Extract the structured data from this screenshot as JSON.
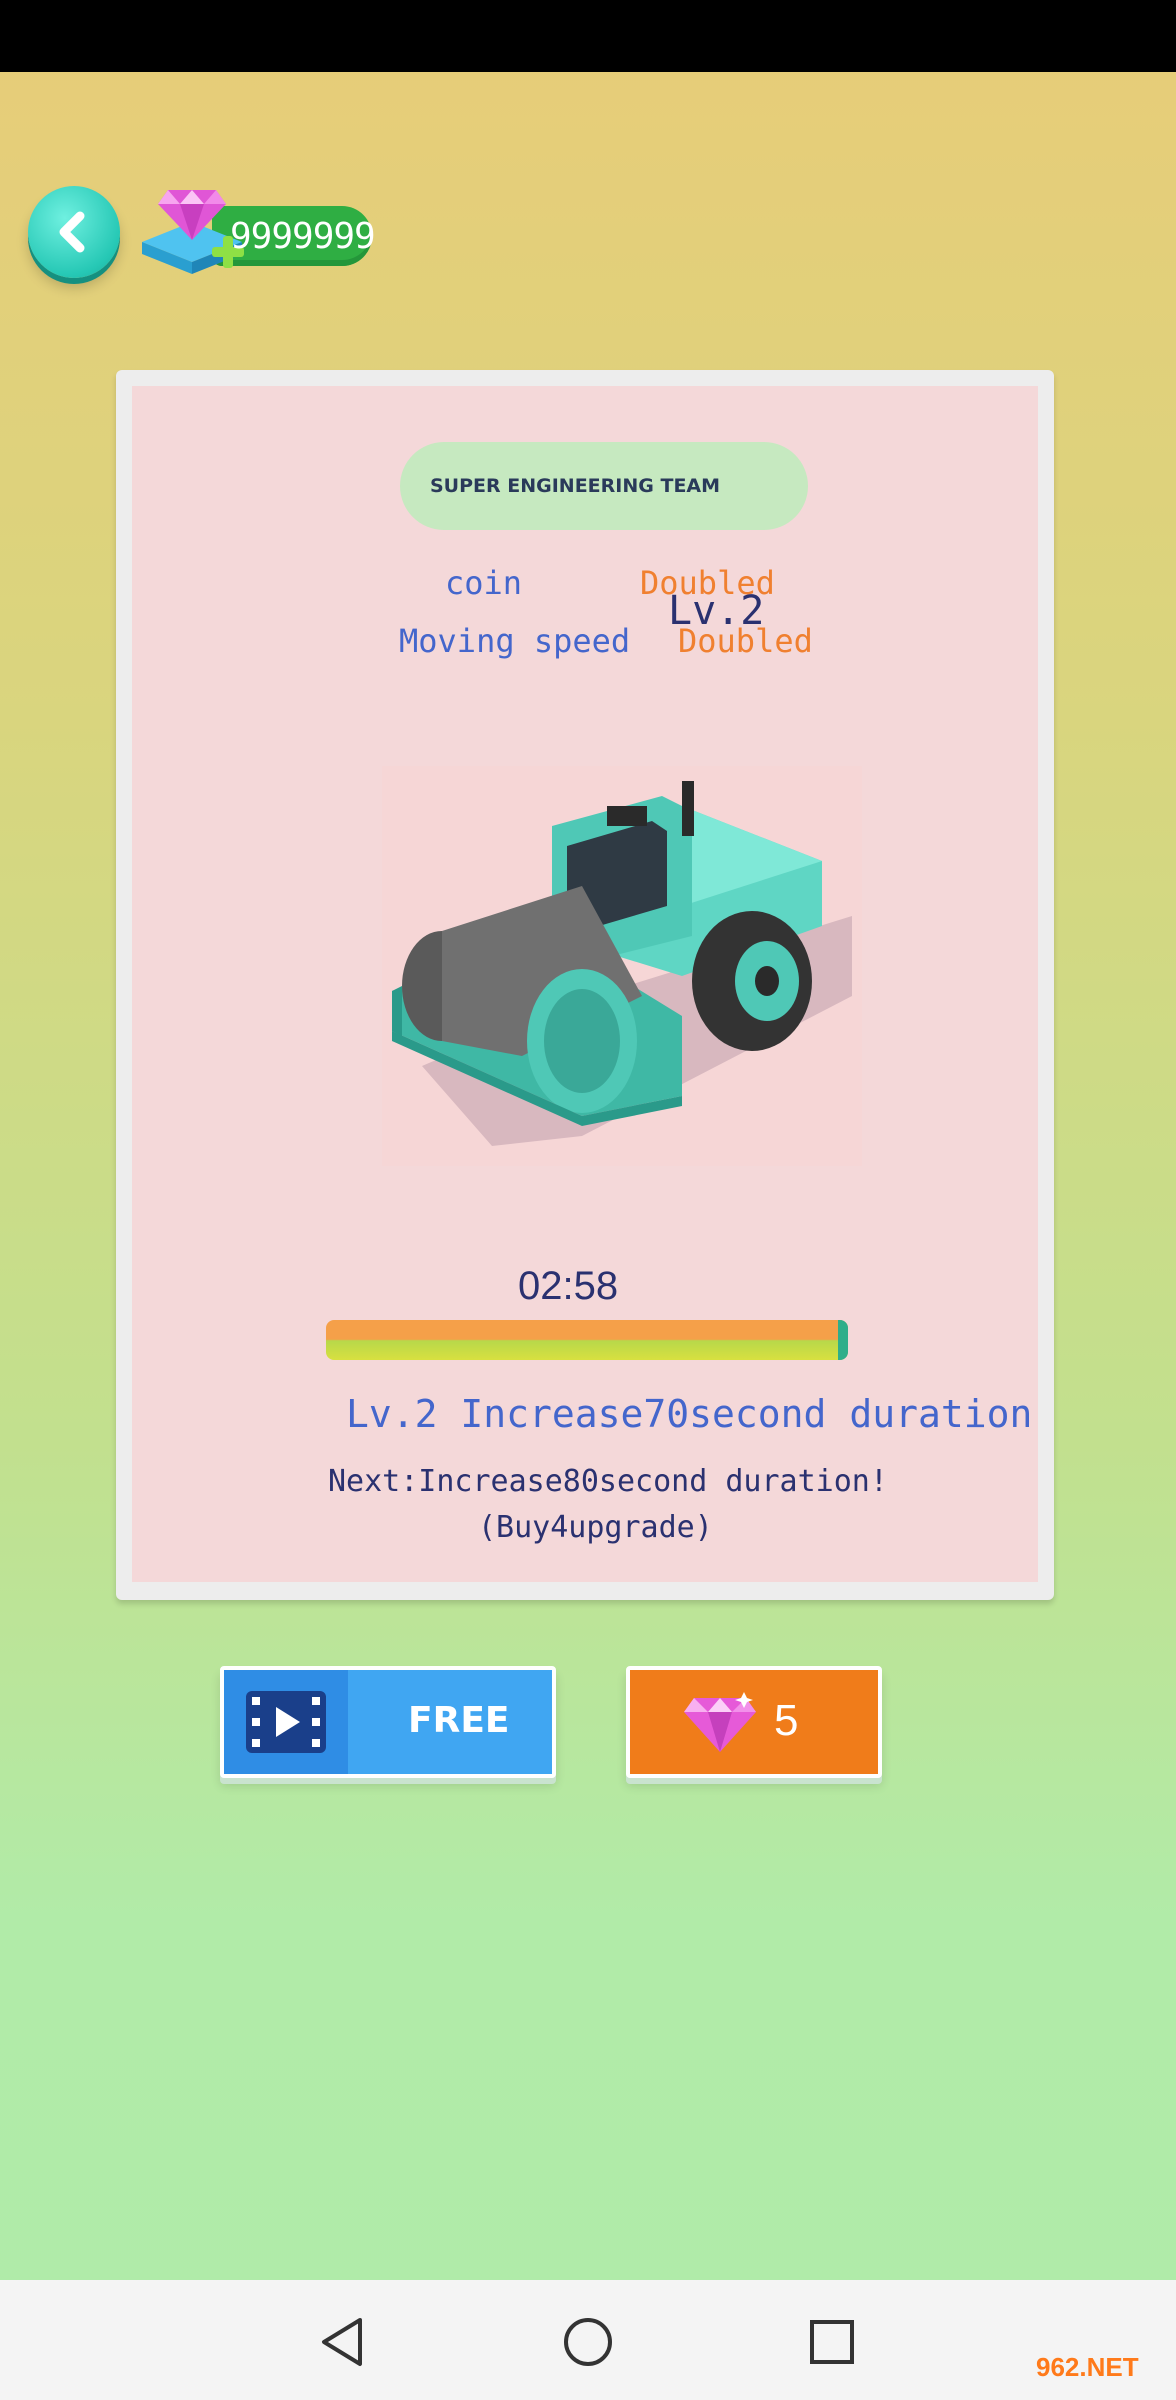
{
  "header": {
    "gem_count": "9999999",
    "back_icon": "chevron-left-icon",
    "gem_icon": "diamond-icon",
    "add_icon": "plus-icon"
  },
  "card": {
    "team_title": "SUPER ENGINEERING TEAM",
    "bonus_rows": [
      {
        "label": "coin",
        "value": "Doubled"
      },
      {
        "label": "Moving speed",
        "value": "Doubled"
      }
    ],
    "level_overlay": "Lv.2",
    "vehicle": "road-roller-image",
    "timer": "02:58",
    "progress_fraction": 1.0,
    "current_effect": "Lv.2 Increase70second duration",
    "next_effect": "Next:Increase80second duration!",
    "buy_hint": "(Buy4upgrade)"
  },
  "actions": {
    "free_label": "FREE",
    "free_icon": "video-film-icon",
    "gem_price": "5",
    "gem_price_icon": "diamond-icon"
  },
  "navbar": {
    "back": "triangle-back-icon",
    "home": "circle-home-icon",
    "recents": "square-recents-icon"
  },
  "watermark": "962.NET",
  "colors": {
    "accent_teal": "#26c8b5",
    "text_blue": "#4466cc",
    "text_orange": "#f08030",
    "free_button": "#40a6f2",
    "gem_button": "#f07c1a"
  }
}
